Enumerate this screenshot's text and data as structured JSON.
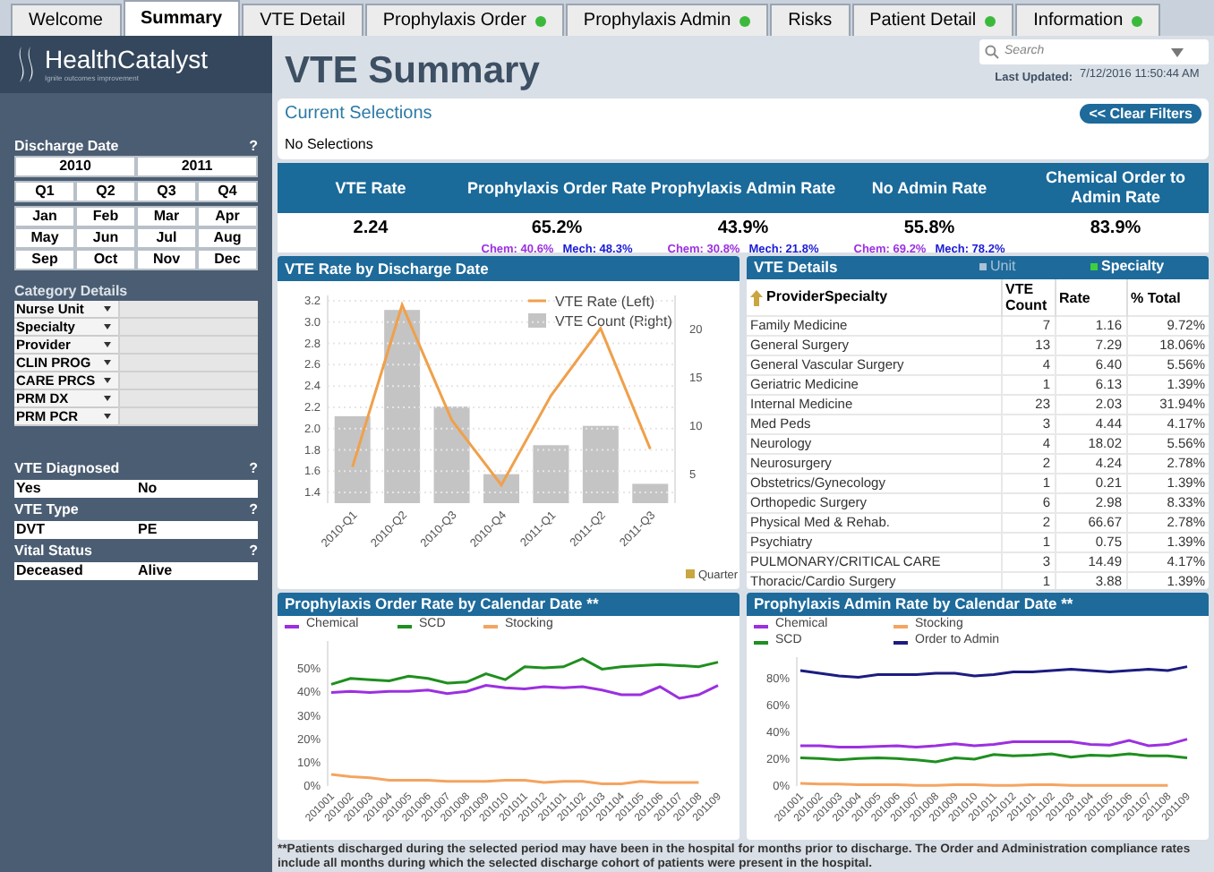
{
  "tabs": [
    {
      "label": "Welcome",
      "selected": false,
      "dot": false
    },
    {
      "label": "Summary",
      "selected": true,
      "dot": false
    },
    {
      "label": "VTE Detail",
      "selected": false,
      "dot": false
    },
    {
      "label": "Prophylaxis Order",
      "selected": false,
      "dot": true
    },
    {
      "label": "Prophylaxis Admin",
      "selected": false,
      "dot": true
    },
    {
      "label": "Risks",
      "selected": false,
      "dot": false
    },
    {
      "label": "Patient Detail",
      "selected": false,
      "dot": true
    },
    {
      "label": "Information",
      "selected": false,
      "dot": true
    }
  ],
  "sidebar": {
    "logo": {
      "name": "HealthCatalyst",
      "tagline": "Ignite outcomes improvement"
    },
    "discharge_date": {
      "title": "Discharge Date",
      "help": "?",
      "years": [
        {
          "label": "2010",
          "selected": false
        },
        {
          "label": "2011",
          "selected": false
        }
      ],
      "quarters": [
        {
          "label": "Q1",
          "selected": false
        },
        {
          "label": "Q2",
          "selected": false
        },
        {
          "label": "Q3",
          "selected": false
        },
        {
          "label": "Q4",
          "selected": false
        }
      ],
      "months": [
        {
          "label": "Jan",
          "selected": false
        },
        {
          "label": "Feb",
          "selected": false
        },
        {
          "label": "Mar",
          "selected": false
        },
        {
          "label": "Apr",
          "selected": false
        },
        {
          "label": "May",
          "selected": false
        },
        {
          "label": "Jun",
          "selected": false
        },
        {
          "label": "Jul",
          "selected": false
        },
        {
          "label": "Aug",
          "selected": false
        },
        {
          "label": "Sep",
          "selected": false
        },
        {
          "label": "Oct",
          "selected": false
        },
        {
          "label": "Nov",
          "selected": false
        },
        {
          "label": "Dec",
          "selected": false
        }
      ]
    },
    "category_details": {
      "title": "Category Details",
      "rows": [
        {
          "label": "Nurse Unit"
        },
        {
          "label": "Specialty"
        },
        {
          "label": "Provider"
        },
        {
          "label": "CLIN PROG"
        },
        {
          "label": "CARE PRCS"
        },
        {
          "label": "PRM DX"
        },
        {
          "label": "PRM PCR"
        }
      ]
    },
    "filters": [
      {
        "title": "VTE Diagnosed",
        "help": "?",
        "options": [
          {
            "label": "Yes",
            "selected": false
          },
          {
            "label": "No",
            "selected": false
          }
        ]
      },
      {
        "title": "VTE Type",
        "help": "?",
        "options": [
          {
            "label": "DVT",
            "selected": false
          },
          {
            "label": "PE",
            "selected": false
          }
        ]
      },
      {
        "title": "Vital Status",
        "help": "?",
        "options": [
          {
            "label": "Deceased",
            "selected": false
          },
          {
            "label": "Alive",
            "selected": false
          }
        ]
      }
    ]
  },
  "header": {
    "title": "VTE Summary",
    "search": {
      "placeholder": "Search"
    },
    "last_updated_label": "Last Updated:",
    "last_updated": "7/12/2016 11:50:44 AM"
  },
  "current_selections": {
    "title": "Current Selections",
    "clear_button": "<< Clear Filters",
    "text": "No Selections"
  },
  "kpis": [
    {
      "label": "VTE Rate",
      "value": "2.24"
    },
    {
      "label": "Prophylaxis Order Rate",
      "value": "65.2%",
      "chem": "Chem: 40.6%",
      "mech": "Mech: 48.3%"
    },
    {
      "label": "Prophylaxis Admin Rate",
      "value": "43.9%",
      "chem": "Chem: 30.8%",
      "mech": "Mech: 21.8%"
    },
    {
      "label": "No Admin Rate",
      "value": "55.8%",
      "chem": "Chem: 69.2%",
      "mech": "Mech: 78.2%"
    },
    {
      "label": "Chemical Order to Admin Rate",
      "value": "83.9%"
    }
  ],
  "vte_chart": {
    "title": "VTE Rate by Discharge Date",
    "count": {
      "chart_data": {
        "type": "bar",
        "xlabel": "Quarter",
        "categories": [
          "2010-Q1",
          "2010-Q2",
          "2010-Q3",
          "2010-Q4",
          "2011-Q1",
          "2011-Q2",
          "2011-Q3"
        ],
        "series": [
          {
            "name": "VTE Count (Right)",
            "color": "#c4c4c4",
            "values": [
              11,
              22,
              12,
              5,
              8,
              10,
              4
            ]
          }
        ],
        "ylim": [
          2,
          23.5
        ],
        "yticks": [
          5,
          10,
          15,
          20
        ]
      }
    },
    "rate": {
      "chart_data": {
        "type": "line",
        "grid": true,
        "series": [
          {
            "name": "VTE Rate (Left)",
            "color": "#f0a04b",
            "values": [
              1.64,
              3.16,
              2.08,
              1.47,
              2.31,
              2.94,
              1.81
            ]
          }
        ],
        "ylim": [
          1.3,
          3.25
        ],
        "yticks": [
          {
            "value": 1.4,
            "label": "1.4"
          },
          {
            "value": 1.6,
            "label": "1.6"
          },
          {
            "value": 1.8,
            "label": "1.8"
          },
          {
            "value": 2.0,
            "label": "2.0"
          },
          {
            "value": 2.2,
            "label": "2.2"
          },
          {
            "value": 2.4,
            "label": "2.4"
          },
          {
            "value": 2.6,
            "label": "2.6"
          },
          {
            "value": 2.8,
            "label": "2.8"
          },
          {
            "value": 3.0,
            "label": "3.0"
          },
          {
            "value": 3.2,
            "label": "3.2"
          }
        ]
      }
    }
  },
  "vte_details": {
    "title": "VTE Details",
    "views": [
      {
        "label": "Unit",
        "selected": false
      },
      {
        "label": "Specialty",
        "selected": true
      }
    ],
    "columns": [
      "ProviderSpecialty",
      "VTE Count",
      "Rate",
      "% Total"
    ],
    "rows": [
      [
        "Family Medicine",
        "7",
        "1.16",
        "9.72%"
      ],
      [
        "General Surgery",
        "13",
        "7.29",
        "18.06%"
      ],
      [
        "General Vascular Surgery",
        "4",
        "6.40",
        "5.56%"
      ],
      [
        "Geriatric Medicine",
        "1",
        "6.13",
        "1.39%"
      ],
      [
        "Internal Medicine",
        "23",
        "2.03",
        "31.94%"
      ],
      [
        "Med Peds",
        "3",
        "4.44",
        "4.17%"
      ],
      [
        "Neurology",
        "4",
        "18.02",
        "5.56%"
      ],
      [
        "Neurosurgery",
        "2",
        "4.24",
        "2.78%"
      ],
      [
        "Obstetrics/Gynecology",
        "1",
        "0.21",
        "1.39%"
      ],
      [
        "Orthopedic Surgery",
        "6",
        "2.98",
        "8.33%"
      ],
      [
        "Physical Med & Rehab.",
        "2",
        "66.67",
        "2.78%"
      ],
      [
        "Psychiatry",
        "1",
        "0.75",
        "1.39%"
      ],
      [
        "PULMONARY/CRITICAL CARE",
        "3",
        "14.49",
        "4.17%"
      ],
      [
        "Thoracic/Cardio Surgery",
        "1",
        "3.88",
        "1.39%"
      ]
    ]
  },
  "order_chart": {
    "chart_data": {
      "type": "line",
      "title": "Prophylaxis Order Rate by Calendar Date **",
      "categories": [
        "201001",
        "201002",
        "201003",
        "201004",
        "201005",
        "201006",
        "201007",
        "201008",
        "201009",
        "201010",
        "201011",
        "201012",
        "201101",
        "201102",
        "201103",
        "201104",
        "201105",
        "201106",
        "201107",
        "201108",
        "201109"
      ],
      "series": [
        {
          "name": "Chemical",
          "color": "#9b30e0",
          "values": [
            40,
            40.5,
            40,
            40.5,
            40.5,
            41,
            39.5,
            40.5,
            43,
            42,
            41.5,
            42.5,
            42,
            42.5,
            41,
            39,
            39,
            42.5,
            37.5,
            39,
            43
          ]
        },
        {
          "name": "SCD",
          "color": "#1f8f1f",
          "values": [
            43.5,
            46,
            45.5,
            45,
            47,
            46,
            44,
            44.5,
            48,
            45.5,
            51,
            50.5,
            51,
            54.5,
            50,
            51,
            51.5,
            52,
            51.5,
            51,
            53
          ]
        },
        {
          "name": "Stocking",
          "color": "#f4a460",
          "values": [
            5,
            4,
            3.5,
            2.5,
            2.5,
            2.5,
            2,
            2,
            2,
            2.5,
            2.5,
            1.5,
            2,
            2,
            1,
            1,
            2,
            1.5,
            1.5,
            1.5,
            null
          ]
        }
      ],
      "ylim": [
        0,
        62
      ],
      "yticks": [
        {
          "value": 0,
          "label": "0%"
        },
        {
          "value": 10,
          "label": "10%"
        },
        {
          "value": 20,
          "label": "20%"
        },
        {
          "value": 30,
          "label": "30%"
        },
        {
          "value": 40,
          "label": "40%"
        },
        {
          "value": 50,
          "label": "50%"
        }
      ]
    }
  },
  "admin_chart": {
    "chart_data": {
      "type": "line",
      "title": "Prophylaxis Admin Rate by Calendar Date **",
      "categories": [
        "201001",
        "201002",
        "201003",
        "201004",
        "201005",
        "201006",
        "201007",
        "201008",
        "201009",
        "201010",
        "201011",
        "201012",
        "201101",
        "201102",
        "201103",
        "201104",
        "201105",
        "201106",
        "201107",
        "201108",
        "201109"
      ],
      "series": [
        {
          "name": "Chemical",
          "color": "#9b30e0",
          "values": [
            30,
            30,
            29,
            29,
            29.5,
            30,
            29,
            30,
            31.5,
            30,
            31,
            33,
            33,
            33,
            33,
            31,
            30.5,
            34,
            30,
            31,
            35
          ]
        },
        {
          "name": "Stocking",
          "color": "#f4a460",
          "values": [
            2,
            1.5,
            1.5,
            1,
            1,
            1,
            0.5,
            0.5,
            1,
            1,
            0.5,
            0.5,
            1,
            1,
            0.5,
            0.5,
            0.5,
            0.5,
            0.5,
            0.5,
            null
          ]
        },
        {
          "name": "SCD",
          "color": "#1f8f1f",
          "values": [
            21,
            20.5,
            19.5,
            20.5,
            21,
            20.5,
            19.5,
            18,
            21,
            20,
            23.5,
            22.5,
            23,
            24,
            21.5,
            23,
            22.5,
            24,
            22.5,
            22.5,
            21
          ]
        },
        {
          "name": "Order to Admin",
          "color": "#1c1c80",
          "values": [
            86,
            84,
            82,
            81,
            83,
            83,
            83,
            84,
            84,
            82,
            83,
            85,
            85,
            86,
            87,
            86,
            85,
            86,
            87,
            86,
            89
          ]
        }
      ],
      "ylim": [
        0,
        96
      ],
      "yticks": [
        {
          "value": 0,
          "label": "0%"
        },
        {
          "value": 20,
          "label": "20%"
        },
        {
          "value": 40,
          "label": "40%"
        },
        {
          "value": 60,
          "label": "60%"
        },
        {
          "value": 80,
          "label": "80%"
        }
      ]
    }
  },
  "footnote": "**Patients discharged during the selected period may have been in the hospital for months prior to discharge.  The Order and Administration compliance rates include all months during which the selected discharge cohort of patients were present in the hospital."
}
